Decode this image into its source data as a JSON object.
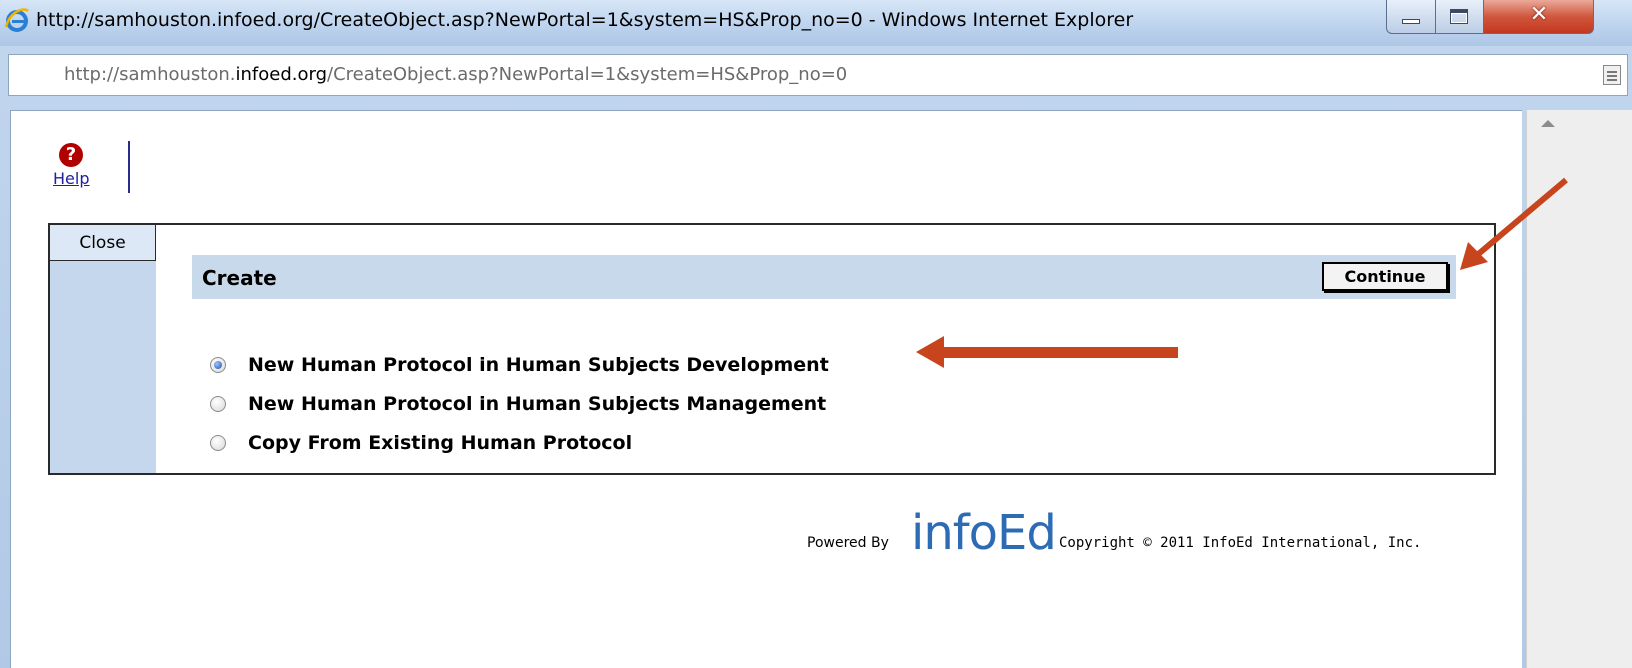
{
  "window": {
    "title": "http://samhouston.infoed.org/CreateObject.asp?NewPortal=1&system=HS&Prop_no=0 - Windows Internet Explorer"
  },
  "address_bar": {
    "url_prefix": "http://samhouston.",
    "url_domain": "infoed.org",
    "url_path": "/CreateObject.asp?NewPortal=1&system=HS&Prop_no=0"
  },
  "help": {
    "icon": "question-mark-icon",
    "label": "Help"
  },
  "nav": {
    "close_label": "Close"
  },
  "create": {
    "title": "Create",
    "continue_label": "Continue",
    "options": [
      {
        "label": "New Human Protocol in Human Subjects Development",
        "selected": true
      },
      {
        "label": "New Human Protocol in Human Subjects Management",
        "selected": false
      },
      {
        "label": "Copy From Existing Human Protocol",
        "selected": false
      }
    ]
  },
  "footer": {
    "powered_by": "Powered By",
    "logo": "infoEd",
    "copyright": "Copyright © 2011 InfoEd International, Inc."
  },
  "colors": {
    "header_bg": "#c9d9ec",
    "nav_bg": "#c5d7ec",
    "logo_blue": "#2e6bb5",
    "annotation_arrow": "#c8441d",
    "help_red": "#b00000"
  }
}
